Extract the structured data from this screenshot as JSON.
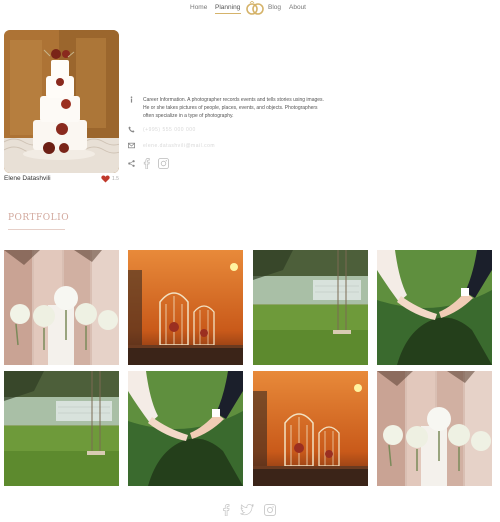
{
  "nav": {
    "items": [
      "Home",
      "Planning",
      "Blog",
      "About"
    ],
    "active": "Planning",
    "logo_icon": "double-rings-logo-icon"
  },
  "profile": {
    "name": "Elene Datashvili",
    "likes_count": "1.5",
    "about": "Career Information. A photographer records events and tells stories using images. He or she takes pictures of people, places, events, and objects. Photographers often specialize in a type of photography.",
    "phone": "(+995) 555 000 000",
    "email": "elene.datashvili@mail.com",
    "icons": {
      "info": "info-icon",
      "phone": "phone-icon",
      "email": "mail-icon",
      "share": "share-icon",
      "facebook": "facebook-icon",
      "instagram": "instagram-icon",
      "heart": "heart-icon"
    }
  },
  "portfolio": {
    "title": "PORTFOLIO",
    "tiles": [
      "bridesmaids-bouquets",
      "birdcages-sunset",
      "garden-swing",
      "holding-hands",
      "garden-swing",
      "holding-hands",
      "birdcages-sunset",
      "bridesmaids-bouquets"
    ]
  },
  "footer": {
    "icons": [
      "facebook-icon",
      "twitter-icon",
      "instagram-icon"
    ]
  },
  "colors": {
    "accent": "#d2a89d",
    "gold": "#d5b36a",
    "heart": "#c0392b"
  }
}
